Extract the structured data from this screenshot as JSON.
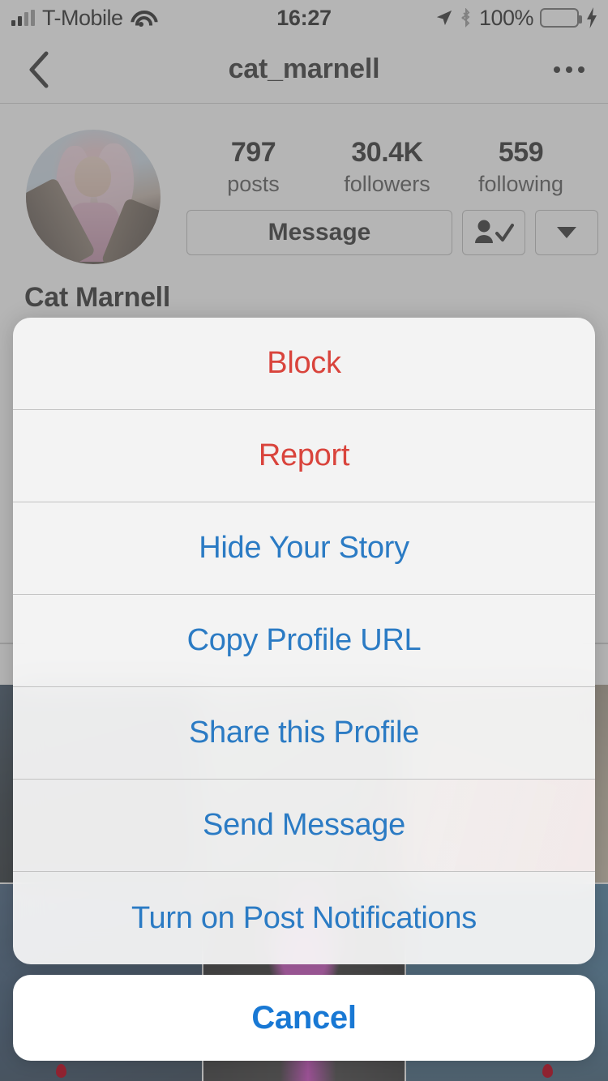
{
  "status_bar": {
    "carrier": "T-Mobile",
    "time": "16:27",
    "battery_percent": "100%",
    "icons": [
      "signal-bars-icon",
      "wifi-icon",
      "location-arrow-icon",
      "bluetooth-icon",
      "battery-icon",
      "charging-bolt-icon"
    ],
    "battery_color": "#3a9e3a"
  },
  "nav": {
    "title": "cat_marnell",
    "back_icon": "back-chevron-icon",
    "more_icon": "more-options-icon"
  },
  "profile": {
    "full_name": "Cat Marnell",
    "stats": [
      {
        "value": "797",
        "label": "posts"
      },
      {
        "value": "30.4K",
        "label": "followers"
      },
      {
        "value": "559",
        "label": "following"
      }
    ],
    "buttons": {
      "message_label": "Message",
      "following_icon": "person-check-icon",
      "dropdown_icon": "chevron-down-icon"
    }
  },
  "action_sheet": {
    "items": [
      {
        "label": "Block",
        "style": "destructive"
      },
      {
        "label": "Report",
        "style": "destructive"
      },
      {
        "label": "Hide Your Story",
        "style": "normal"
      },
      {
        "label": "Copy Profile URL",
        "style": "normal"
      },
      {
        "label": "Share this Profile",
        "style": "normal"
      },
      {
        "label": "Send Message",
        "style": "normal"
      },
      {
        "label": "Turn on Post Notifications",
        "style": "normal"
      }
    ],
    "cancel_label": "Cancel",
    "destructive_color": "#d9443c",
    "normal_color": "#2b7bc4",
    "cancel_color": "#1878d4"
  }
}
